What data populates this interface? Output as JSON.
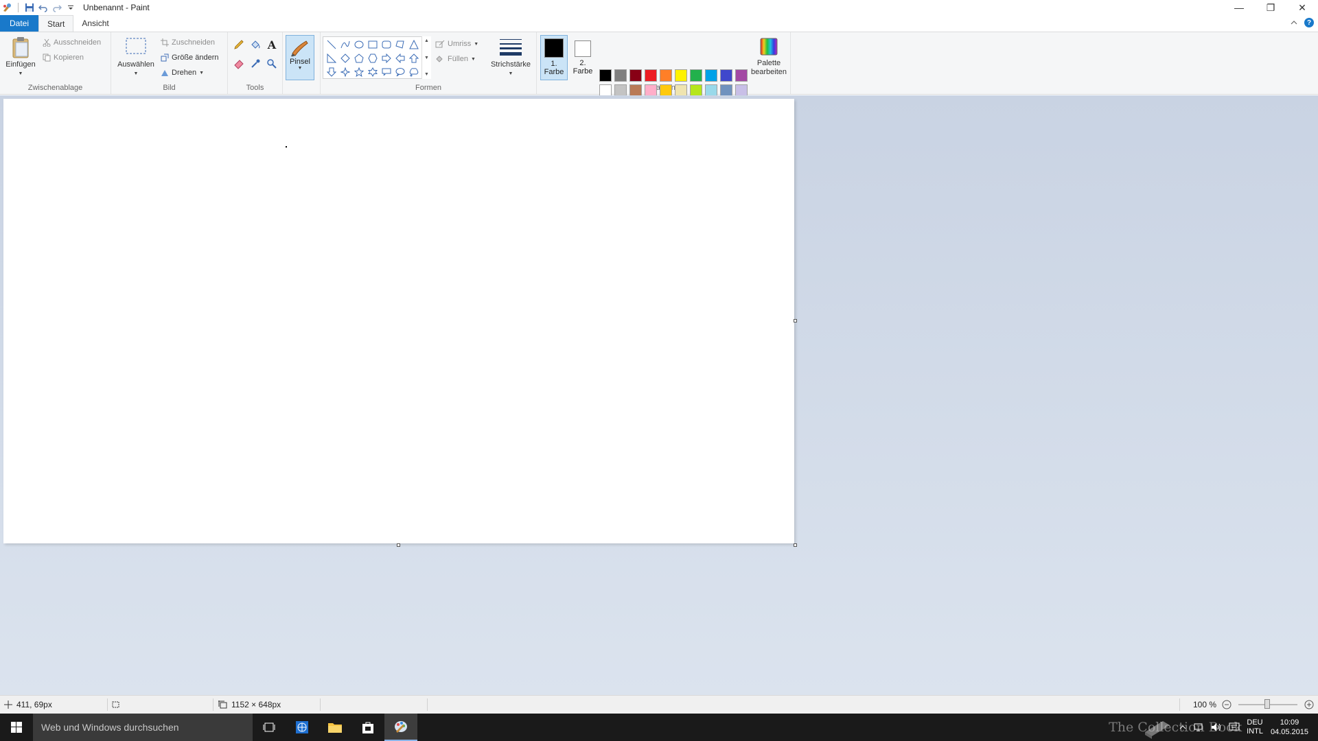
{
  "window": {
    "title": "Unbenannt - Paint",
    "minimize": "—",
    "restore": "❐",
    "close": "✕"
  },
  "tabs": [
    {
      "label": "Datei"
    },
    {
      "label": "Start"
    },
    {
      "label": "Ansicht"
    }
  ],
  "ribbon": {
    "clipboard": {
      "label": "Zwischenablage",
      "paste": "Einfügen",
      "cut": "Ausschneiden",
      "copy": "Kopieren"
    },
    "image": {
      "label": "Bild",
      "select": "Auswählen",
      "crop": "Zuschneiden",
      "resize": "Größe ändern",
      "rotate": "Drehen"
    },
    "tools": {
      "label": "Tools"
    },
    "brush": {
      "label": "Pinsel"
    },
    "shapes": {
      "label": "Formen",
      "outline": "Umriss",
      "fill": "Füllen"
    },
    "stroke": {
      "label": "Strichstärke"
    },
    "colors": {
      "label": "Farben",
      "color1": "1. Farbe",
      "color2": "2. Farbe",
      "edit_palette": "Palette bearbeiten",
      "color1_value": "#000000",
      "color2_value": "#ffffff",
      "palette": [
        "#000000",
        "#7f7f7f",
        "#880015",
        "#ed1c24",
        "#ff7f27",
        "#fff200",
        "#22b14c",
        "#00a2e8",
        "#3f48cc",
        "#a349a4",
        "#ffffff",
        "#c3c3c3",
        "#b97a57",
        "#ffaec9",
        "#ffc90e",
        "#efe4b0",
        "#b5e61d",
        "#99d9ea",
        "#7092be",
        "#c8bfe7",
        "#ffffff",
        "#ffffff",
        "#ffffff",
        "#ffffff",
        "#ffffff",
        "#ffffff",
        "#ffffff",
        "#ffffff",
        "#ffffff",
        "#ffffff"
      ]
    }
  },
  "status": {
    "cursor": "411, 69px",
    "canvas_size": "1152 × 648px",
    "zoom": "100 %"
  },
  "taskbar": {
    "search_placeholder": "Web und Windows durchsuchen",
    "lang_top": "DEU",
    "lang_bottom": "INTL",
    "time": "10:09",
    "date": "04.05.2015",
    "watermark": "The Collection Book"
  }
}
